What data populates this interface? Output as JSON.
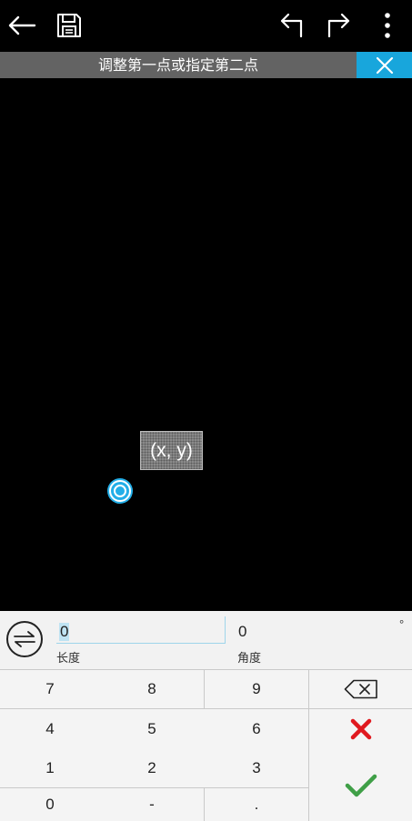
{
  "toolbar": {
    "back_icon": "arrow-left-icon",
    "save_icon": "floppy-disk-icon",
    "undo_icon": "undo-arrow-icon",
    "redo_icon": "redo-arrow-icon",
    "menu_icon": "more-vertical-icon"
  },
  "hint": {
    "text": "调整第一点或指定第二点",
    "close_icon": "close-icon"
  },
  "canvas": {
    "tooltip_text": "(x, y)",
    "point_color": "#22aee8"
  },
  "input": {
    "swap_icon": "swap-arrows-icon",
    "length_value": "0",
    "length_label": "长度",
    "angle_value": "0",
    "angle_label": "角度",
    "angle_unit": "°"
  },
  "keypad": {
    "keys": {
      "k7": "7",
      "k8": "8",
      "k9": "9",
      "k4": "4",
      "k5": "5",
      "k6": "6",
      "k1": "1",
      "k2": "2",
      "k3": "3",
      "k0": "0",
      "minus": "-",
      "dot": "."
    },
    "backspace_icon": "backspace-icon",
    "cancel_icon": "red-x-icon",
    "confirm_icon": "green-check-icon"
  },
  "colors": {
    "accent": "#18a6dc",
    "hint_bar": "#636363",
    "cancel": "#e0191f",
    "confirm": "#3f9f47"
  }
}
